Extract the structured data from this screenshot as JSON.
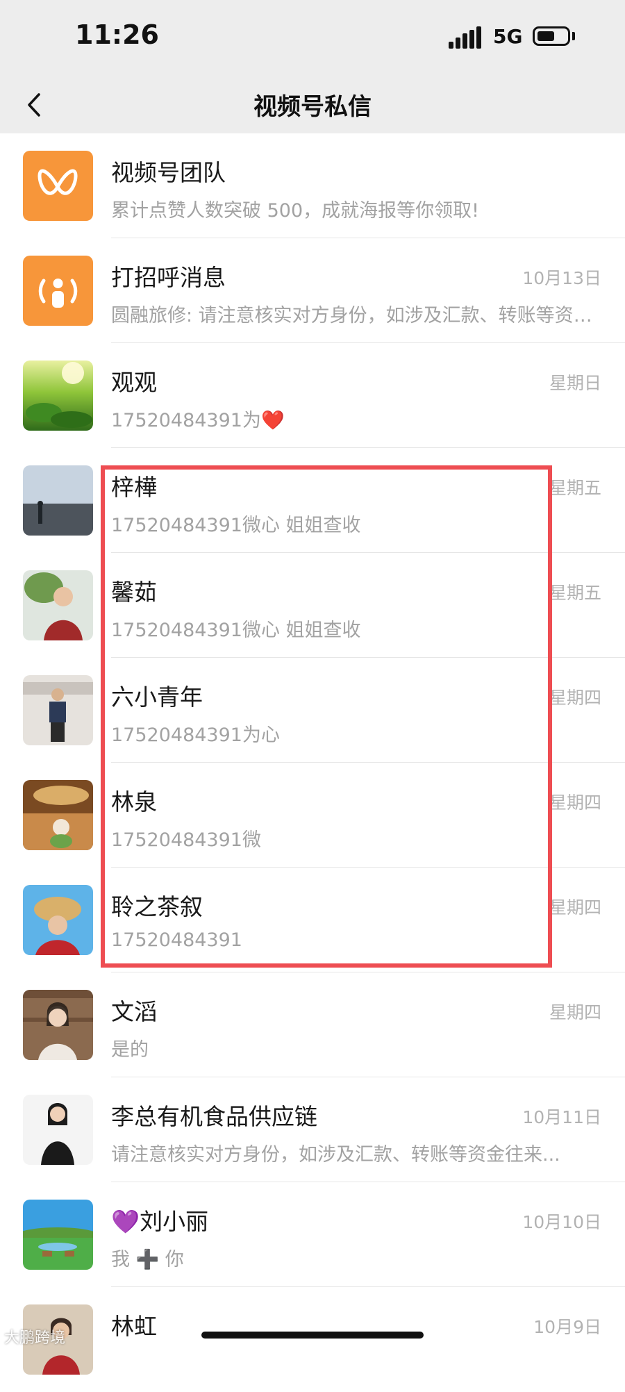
{
  "status_bar": {
    "time": "11:26",
    "network": "5G"
  },
  "header": {
    "title": "视频号私信"
  },
  "colors": {
    "accent_orange": "#f7963a",
    "highlight_red": "#ee4d52"
  },
  "conversations": [
    {
      "name": "视频号团队",
      "preview": "累计点赞人数突破 500，成就海报等你领取!",
      "time": "",
      "avatar": "channels-team-logo"
    },
    {
      "name": "打招呼消息",
      "preview": "圆融旅修: 请注意核实对方身份，如涉及汇款、转账等资金往来...",
      "time": "10月13日",
      "avatar": "greeting-broadcast-icon"
    },
    {
      "name": "观观",
      "preview": "17520484391为❤️",
      "time": "星期日",
      "avatar": "tea-field-photo"
    },
    {
      "name": "梓樺",
      "preview": "17520484391微心 姐姐查收",
      "time": "星期五",
      "avatar": "beach-photo"
    },
    {
      "name": "馨茹",
      "preview": "17520484391微心 姐姐查收",
      "time": "星期五",
      "avatar": "woman-portrait-photo"
    },
    {
      "name": "六小青年",
      "preview": "17520484391为心",
      "time": "星期四",
      "avatar": "man-standing-photo"
    },
    {
      "name": "林泉",
      "preview": "17520484391微",
      "time": "星期四",
      "avatar": "figurine-photo"
    },
    {
      "name": "聆之茶叙",
      "preview": "17520484391",
      "time": "星期四",
      "avatar": "woman-straw-hat-photo"
    },
    {
      "name": "文滔",
      "preview": "是的",
      "time": "星期四",
      "avatar": "bookshelf-woman-photo"
    },
    {
      "name": "李总有机食品供应链",
      "preview": "请注意核实对方身份，如涉及汇款、转账等资金往来...",
      "time": "10月11日",
      "avatar": "businesswoman-photo"
    },
    {
      "name": "💜刘小丽",
      "preview": "我 ➕ 你",
      "time": "10月10日",
      "avatar": "deer-landscape-photo"
    },
    {
      "name": "林虹",
      "preview": "",
      "time": "10月9日",
      "avatar": "woman-indoor-photo"
    }
  ],
  "watermark": "大鹏跨境"
}
